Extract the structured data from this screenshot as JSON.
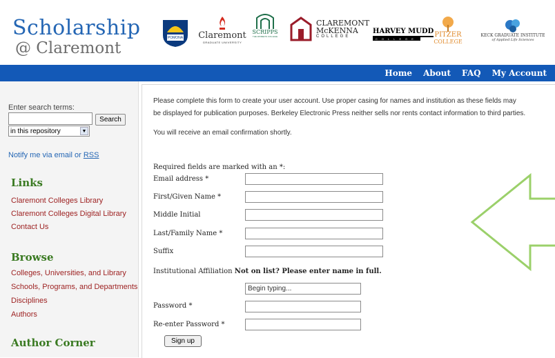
{
  "header": {
    "logo_main": "Scholarship",
    "logo_sub": "@ Claremont",
    "colleges": {
      "pomona": "POMONA COLLEGE",
      "cgu": "Claremont",
      "cgu_sub": "GRADUATE UNIVERSITY",
      "scripps": "SCRIPPS",
      "scripps_sub": "THE WOMEN'S COLLEGE",
      "cmc_line1": "CLAREMONT",
      "cmc_line2": "McKENNA",
      "cmc_line3": "COLLEGE",
      "hmc": "HARVEY MUDD",
      "hmc_sub": "COLLEGE",
      "pitzer": "PITZER",
      "pitzer_sub": "COLLEGE",
      "kgi": "KECK GRADUATE INSTITUTE",
      "kgi_sub": "of Applied Life Sciences"
    }
  },
  "nav": [
    "Home",
    "About",
    "FAQ",
    "My Account"
  ],
  "sidebar": {
    "search_label": "Enter search terms:",
    "search_button": "Search",
    "scope": "in this repository",
    "notify_text": "Notify me via email or",
    "notify_link": "RSS",
    "links_heading": "Links",
    "links": [
      "Claremont Colleges Library",
      "Claremont Colleges Digital Library",
      "Contact Us"
    ],
    "browse_heading": "Browse",
    "browse": [
      "Colleges, Universities, and Library",
      "Schools, Programs, and Departments",
      "Disciplines",
      "Authors"
    ],
    "author_heading": "Author Corner"
  },
  "form": {
    "intro1": "Please complete this form to create your user account. Use proper casing for names and institution as these fields may",
    "intro2": "be displayed for publication purposes. Berkeley Electronic Press neither sells nor rents contact information to third parties.",
    "confirm": "You will receive an email confirmation shortly.",
    "required_note": "Required fields are marked with an *:",
    "email_label": "Email address *",
    "first_label": "First/Given Name *",
    "middle_label": "Middle Initial",
    "last_label": "Last/Family Name *",
    "suffix_label": "Suffix",
    "inst_label": "Institutional Affiliation",
    "inst_note": "Not on list? Please enter name in full.",
    "inst_placeholder": "Begin typing...",
    "password_label": "Password *",
    "reenter_label": "Re-enter Password *",
    "signup_button": "Sign up"
  },
  "colors": {
    "navbar": "#1359b7",
    "logo_blue": "#2466b4",
    "heading_green": "#3a7a22",
    "link_red": "#9c1f1f",
    "arrow_green": "#9bd06a"
  }
}
